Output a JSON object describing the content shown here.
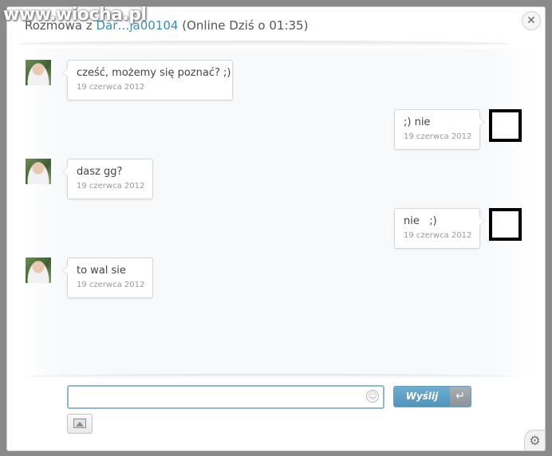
{
  "header": {
    "title_prefix": "Rozmowa z ",
    "username": "Dar…ja00104",
    "status": " (Online Dziś o 01:35)",
    "close_icon": "close-icon"
  },
  "watermark": "www.wiocha.pl",
  "messages": [
    {
      "side": "left",
      "text": "cześć, możemy się poznać? ;)",
      "date": "19 czerwca 2012"
    },
    {
      "side": "right",
      "text": ";) nie",
      "date": "19 czerwca 2012"
    },
    {
      "side": "left",
      "text": "dasz gg?",
      "date": "19 czerwca 2012"
    },
    {
      "side": "right",
      "text": "nie   ;)",
      "date": "19 czerwca 2012"
    },
    {
      "side": "left",
      "text": "to wal sie",
      "date": "19 czerwca 2012"
    }
  ],
  "composer": {
    "value": "",
    "smiley_icon": "smiley-icon",
    "send_label": "Wyślij",
    "send_icon": "enter-icon",
    "photo_icon": "photo-icon"
  },
  "settings_icon": "gear-icon"
}
